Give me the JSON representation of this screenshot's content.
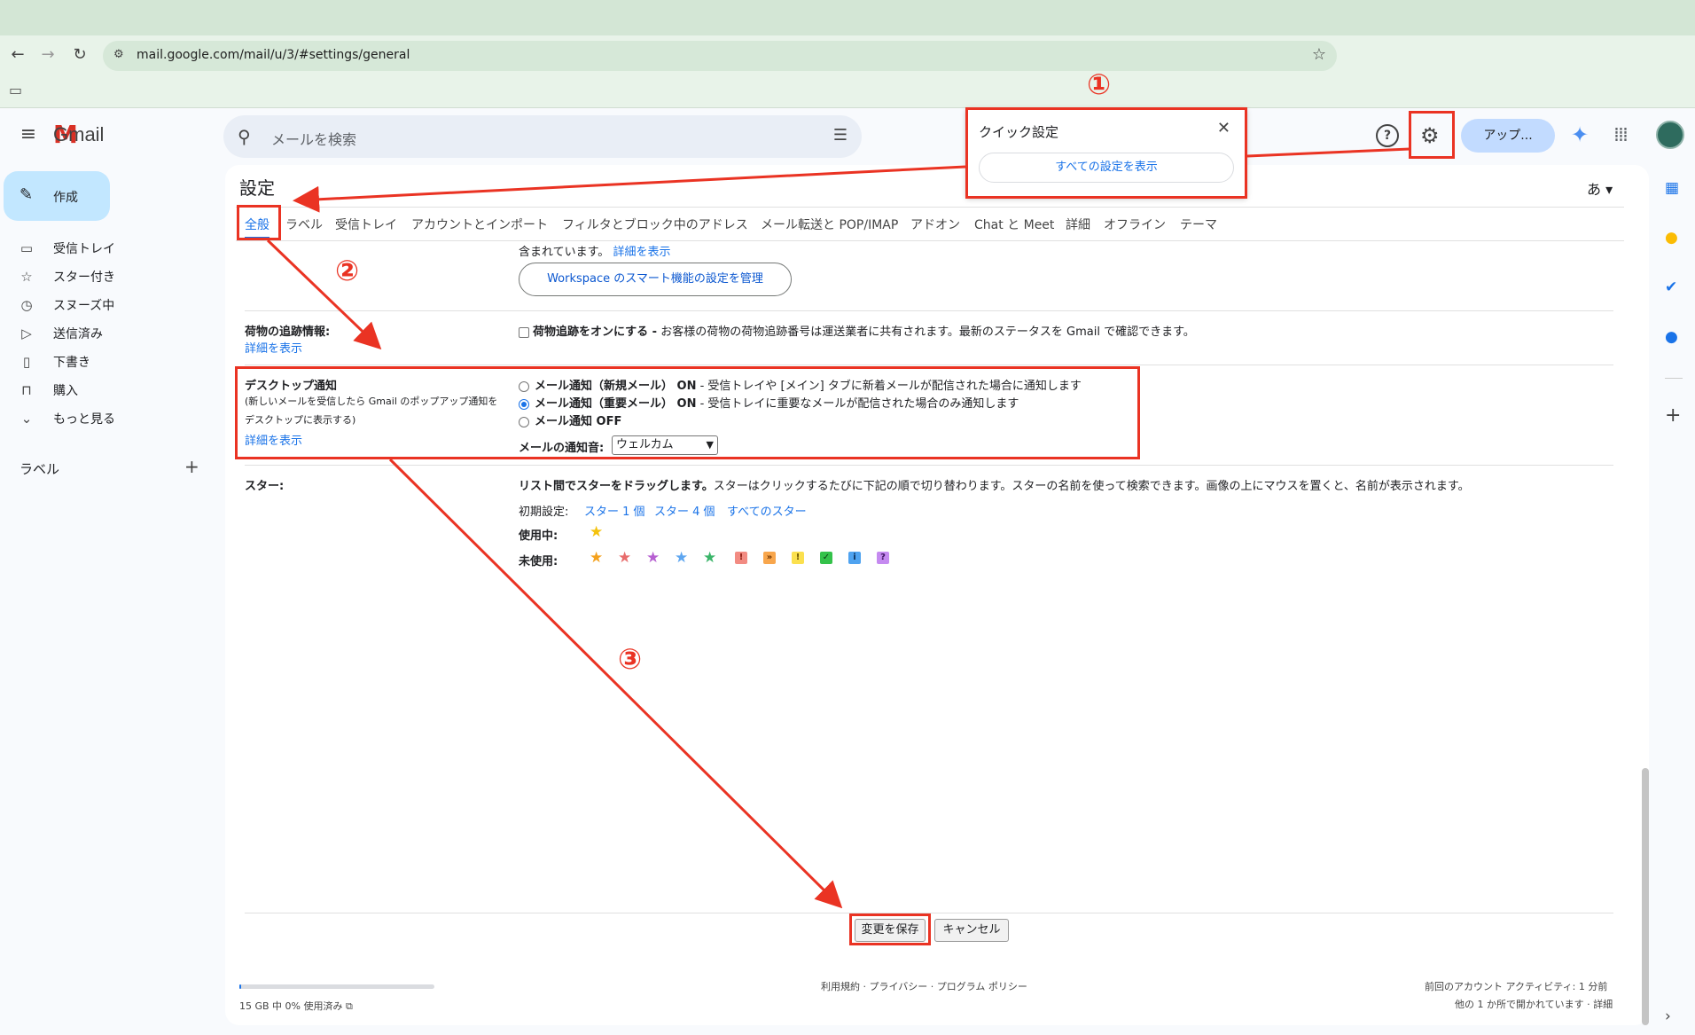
{
  "browser": {
    "url": "mail.google.com/mail/u/3/#settings/general"
  },
  "header": {
    "app_name": "Gmail",
    "search_placeholder": "メールを検索",
    "upgrade_label": "アップ..."
  },
  "sidebar": {
    "compose_label": "作成",
    "items": [
      {
        "label": "受信トレイ",
        "icon": "inbox-icon"
      },
      {
        "label": "スター付き",
        "icon": "star-icon"
      },
      {
        "label": "スヌーズ中",
        "icon": "clock-icon"
      },
      {
        "label": "送信済み",
        "icon": "send-icon"
      },
      {
        "label": "下書き",
        "icon": "draft-icon"
      },
      {
        "label": "購入",
        "icon": "bag-icon"
      },
      {
        "label": "もっと見る",
        "icon": "chevron-down-icon"
      }
    ],
    "labels_header": "ラベル"
  },
  "settings": {
    "title": "設定",
    "input_lang": "あ ▾",
    "tabs": [
      "全般",
      "ラベル",
      "受信トレイ",
      "アカウントとインポート",
      "フィルタとブロック中のアドレス",
      "メール転送と POP/IMAP",
      "アドオン",
      "Chat と Meet",
      "詳細",
      "オフライン",
      "テーマ"
    ],
    "smart": {
      "text": "含まれています。",
      "link": "詳細を表示",
      "button": "Workspace のスマート機能の設定を管理"
    },
    "tracking": {
      "label": "荷物の追跡情報:",
      "link": "詳細を表示",
      "option_bold": "荷物追跡をオンにする -",
      "option_desc": " お客様の荷物の荷物追跡番号は運送業者に共有されます。最新のステータスを Gmail で確認できます。"
    },
    "desktop": {
      "label": "デスクトップ通知",
      "desc1": "(新しいメールを受信したら Gmail のポップアップ通知を",
      "desc2": "デスクトップに表示する)",
      "link": "詳細を表示",
      "options": [
        {
          "bold": "メール通知（新規メール） ON",
          "desc": " - 受信トレイや [メイン] タブに新着メールが配信された場合に通知します",
          "checked": false
        },
        {
          "bold": "メール通知（重要メール） ON",
          "desc": " - 受信トレイに重要なメールが配信された場合のみ通知します",
          "checked": true
        },
        {
          "bold": "メール通知 OFF",
          "desc": "",
          "checked": false
        }
      ],
      "sound_label": "メールの通知音:",
      "sound_value": "ウェルカム"
    },
    "stars": {
      "label": "スター:",
      "drag_bold": "リスト間でスターをドラッグします。",
      "drag_desc": "スターはクリックするたびに下記の順で切り替わります。スターの名前を使って検索できます。画像の上にマウスを置くと、名前が表示されます。",
      "presets_label": "初期設定:",
      "presets": [
        "スター 1 個",
        "スター 4 個",
        "すべてのスター"
      ],
      "in_use_label": "使用中:",
      "unused_label": "未使用:",
      "in_use_color": "#f4c20d",
      "unused_stars": [
        "#f4a11d",
        "#e86c6c",
        "#b65fd1",
        "#5ea6f0",
        "#3bb56a"
      ],
      "unused_marks": [
        {
          "glyph": "!",
          "bg": "#f28b82",
          "fg": "#8b1a10"
        },
        {
          "glyph": "»",
          "bg": "#f8a64c",
          "fg": "#6b3200"
        },
        {
          "glyph": "!",
          "bg": "#fbe04e",
          "fg": "#6b5400"
        },
        {
          "glyph": "✓",
          "bg": "#34c24a",
          "fg": "#0c3e14"
        },
        {
          "glyph": "i",
          "bg": "#4fa3f0",
          "fg": "#0b2e57"
        },
        {
          "glyph": "?",
          "bg": "#c58af0",
          "fg": "#3e1360"
        }
      ]
    },
    "save_label": "変更を保存",
    "cancel_label": "キャンセル"
  },
  "footer": {
    "storage": "15 GB 中 0% 使用済み",
    "storage_fraction": 0.0,
    "links": "利用規約 · プライバシー · プログラム ポリシー",
    "activity1": "前回のアカウント アクティビティ: 1 分前",
    "activity2": "他の 1 か所で開かれています · 詳細"
  },
  "quick_settings": {
    "title": "クイック設定",
    "button": "すべての設定を表示"
  },
  "annotations": {
    "step1": "①",
    "step2": "②",
    "step3": "③",
    "color": "#ea3323"
  }
}
